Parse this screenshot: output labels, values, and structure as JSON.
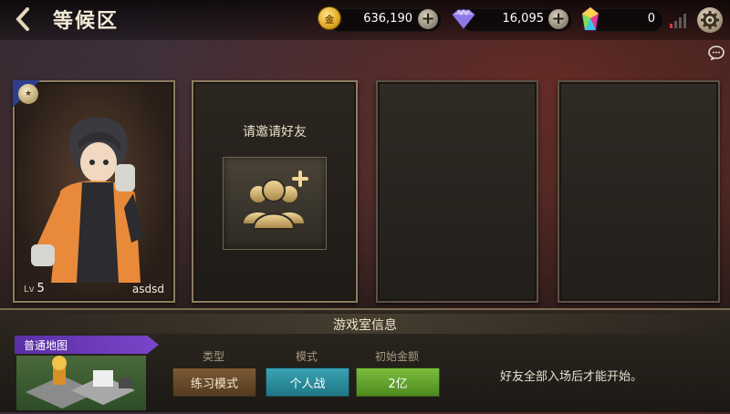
{
  "header": {
    "title": "等候区",
    "back_icon": "chevron-left-icon",
    "gold": "636,190",
    "diamond": "16,095",
    "crystal": "0",
    "gold_icon": "gold-coin-icon",
    "gold_icon_text": "金",
    "diamond_icon": "diamond-icon",
    "crystal_icon": "crystal-icon",
    "signal_icon": "signal-icon",
    "settings_icon": "gear-icon",
    "chat_icon": "chat-bubble-icon"
  },
  "slots": {
    "player": {
      "level_prefix": "Lv",
      "level": "5",
      "name": "asdsd"
    },
    "invite": {
      "label": "请邀请好友",
      "icon": "add-friend-icon"
    }
  },
  "room_info": {
    "title": "游戏室信息",
    "map_tag": "普通地图",
    "type_label": "类型",
    "type_value": "练习模式",
    "mode_label": "模式",
    "mode_value": "个人战",
    "money_label": "初始金额",
    "money_value": "2亿",
    "notice": "好友全部入场后才能开始。"
  },
  "colors": {
    "type_button": "#6b4b2a",
    "mode_button": "#2c8fa0",
    "money_button": "#67a52f",
    "map_tag": "#6a3bb8"
  }
}
